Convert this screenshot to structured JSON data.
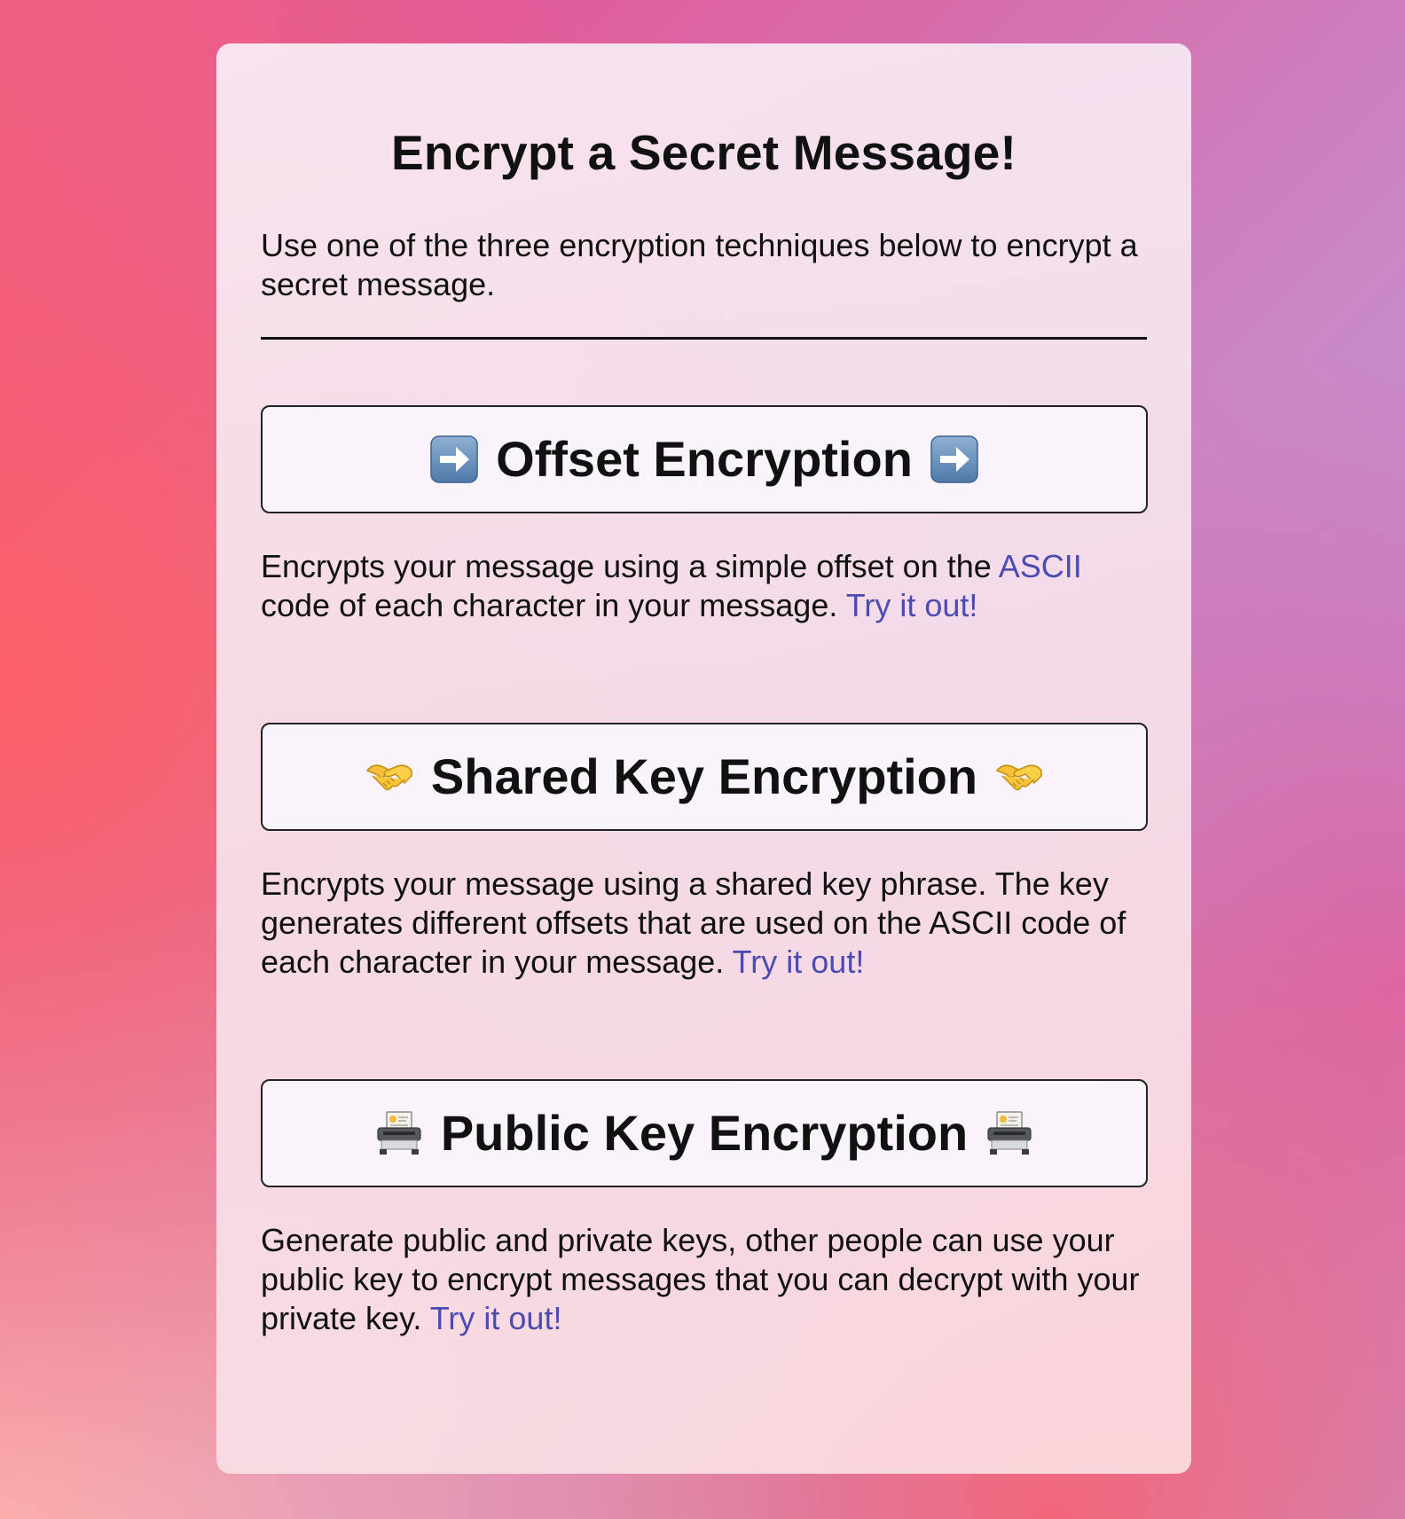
{
  "page": {
    "title": "Encrypt a Secret Message!",
    "intro": "Use one of the three encryption techniques below to encrypt a secret message."
  },
  "sections": [
    {
      "button_label": "Offset Encryption",
      "icon": "right-arrow-icon",
      "description_before": "Encrypts your message using a simple offset on the ",
      "inline_link": "ASCII",
      "description_after": " code of each character in your message. ",
      "try_link": "Try it out!"
    },
    {
      "button_label": "Shared Key Encryption",
      "icon": "handshake-icon",
      "description_before": "Encrypts your message using a shared key phrase. The key generates different offsets that are used on the ASCII code of each character in your message. ",
      "try_link": "Try it out!"
    },
    {
      "button_label": "Public Key Encryption",
      "icon": "fax-machine-icon",
      "description_before": "Generate public and private keys, other people can use your public key to encrypt messages that you can decrypt with your private key. ",
      "try_link": "Try it out!"
    }
  ],
  "colors": {
    "link": "#4c4bb1",
    "button_bg": "#f9f4fb",
    "text": "#111111"
  }
}
